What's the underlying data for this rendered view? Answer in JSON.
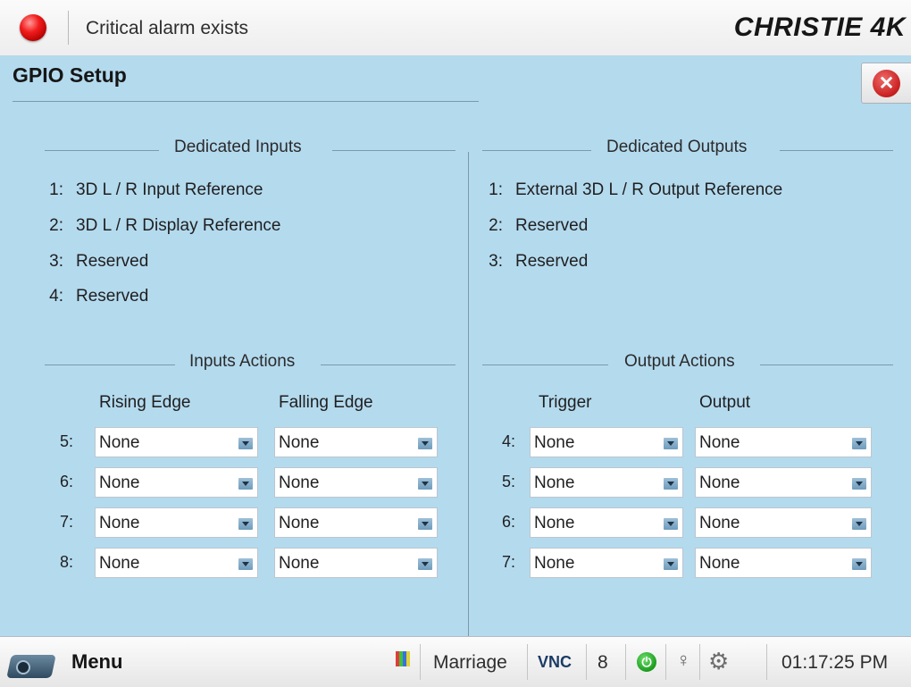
{
  "status_bar": {
    "alarm_text": "Critical alarm exists",
    "brand": "CHRISTIE 4K",
    "alarm_color": "#e01414"
  },
  "page": {
    "title": "GPIO Setup"
  },
  "dedicated_inputs": {
    "heading": "Dedicated Inputs",
    "items": [
      {
        "num": "1:",
        "label": "3D L / R Input Reference"
      },
      {
        "num": "2:",
        "label": "3D L / R Display Reference"
      },
      {
        "num": "3:",
        "label": "Reserved"
      },
      {
        "num": "4:",
        "label": "Reserved"
      }
    ]
  },
  "dedicated_outputs": {
    "heading": "Dedicated Outputs",
    "items": [
      {
        "num": "1:",
        "label": "External 3D L / R Output Reference"
      },
      {
        "num": "2:",
        "label": "Reserved"
      },
      {
        "num": "3:",
        "label": "Reserved"
      }
    ]
  },
  "inputs_actions": {
    "heading": "Inputs Actions",
    "col1": "Rising Edge",
    "col2": "Falling Edge",
    "rows": [
      {
        "num": "5:",
        "rising": "None",
        "falling": "None"
      },
      {
        "num": "6:",
        "rising": "None",
        "falling": "None"
      },
      {
        "num": "7:",
        "rising": "None",
        "falling": "None"
      },
      {
        "num": "8:",
        "rising": "None",
        "falling": "None"
      }
    ]
  },
  "output_actions": {
    "heading": "Output Actions",
    "col1": "Trigger",
    "col2": "Output",
    "rows": [
      {
        "num": "4:",
        "trigger": "None",
        "output": "None"
      },
      {
        "num": "5:",
        "trigger": "None",
        "output": "None"
      },
      {
        "num": "6:",
        "trigger": "None",
        "output": "None"
      },
      {
        "num": "7:",
        "trigger": "None",
        "output": "None"
      }
    ]
  },
  "taskbar": {
    "menu_label": "Menu",
    "marriage": "Marriage",
    "vnc": "VNC",
    "channel": "8",
    "time": "01:17:25 PM"
  },
  "icons": [
    "alarm-led-icon",
    "close-icon",
    "projector-icon",
    "test-pattern-icon",
    "power-icon",
    "lightbulb-icon",
    "gear-icon"
  ],
  "colors": {
    "panel_background": "#b4daee",
    "power_green": "#1b9c1b",
    "close_red": "#c81f1f"
  }
}
